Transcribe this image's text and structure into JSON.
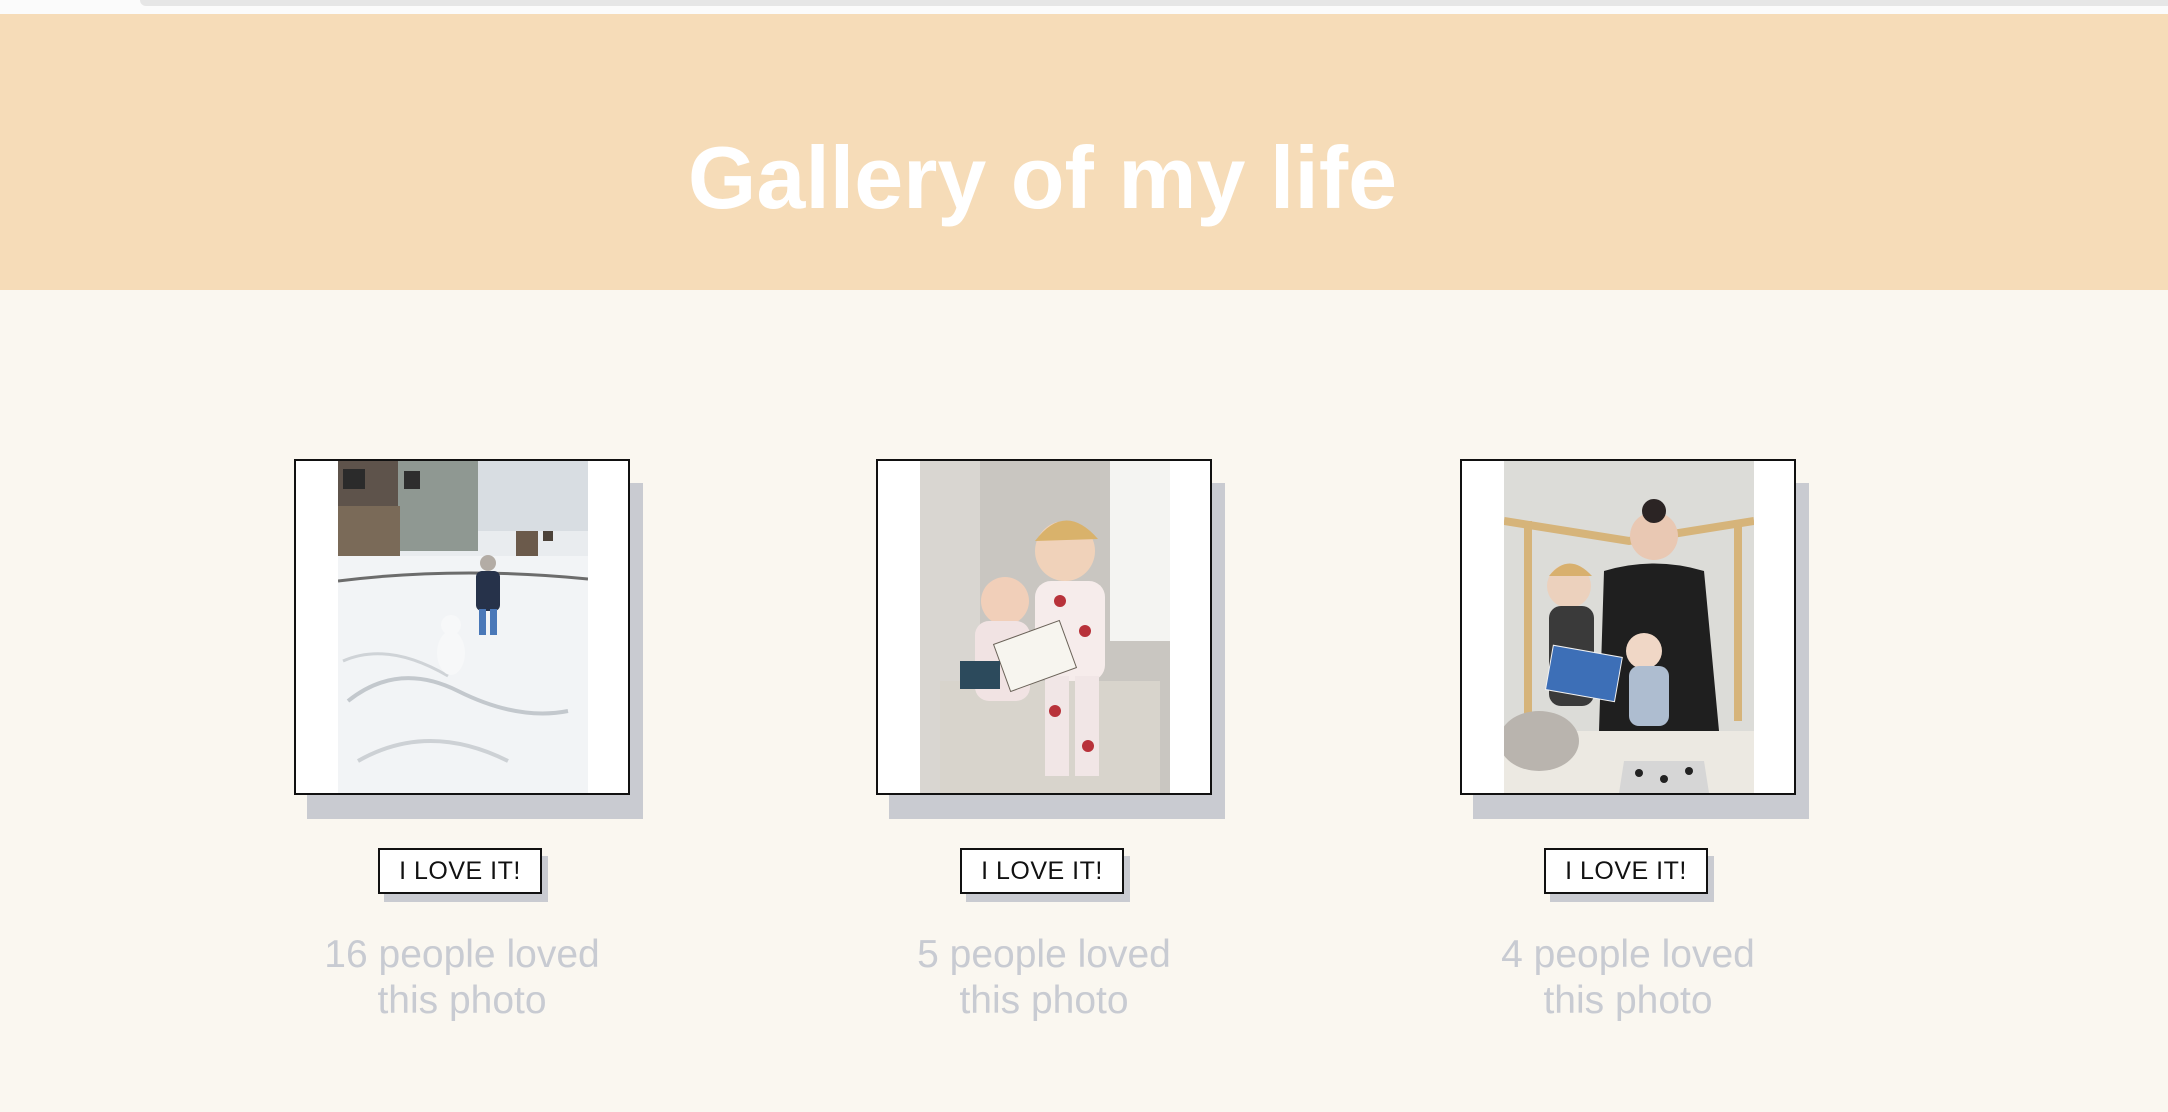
{
  "header": {
    "title": "Gallery of my life",
    "background_color": "#f6dcb8",
    "title_color": "#ffffff"
  },
  "gallery": [
    {
      "photo_icon": "child-in-snow-photo",
      "button_label": "I LOVE IT!",
      "loves": 16,
      "love_text_line1": "16 people loved",
      "love_text_line2": "this photo"
    },
    {
      "photo_icon": "children-reading-on-chair-photo",
      "button_label": "I LOVE IT!",
      "loves": 5,
      "love_text_line1": "5 people loved",
      "love_text_line2": "this photo"
    },
    {
      "photo_icon": "mother-reading-to-kids-photo",
      "button_label": "I LOVE IT!",
      "loves": 4,
      "love_text_line1": "4 people loved",
      "love_text_line2": "this photo"
    }
  ],
  "colors": {
    "page_background": "#faf7f0",
    "shadow": "#c9cbd1",
    "count_text": "#c8cbd2"
  }
}
